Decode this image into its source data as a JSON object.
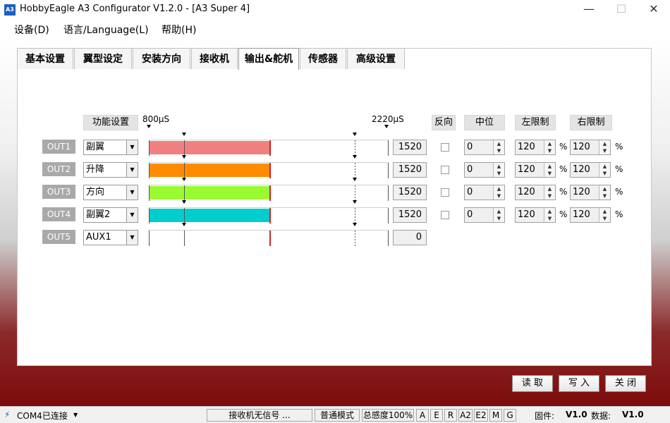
{
  "window": {
    "app_icon_text": "A3",
    "title": "HobbyEagle A3 Configurator V1.2.0 - [A3 Super 4]",
    "minimize": "—",
    "maximize": "☐",
    "close": "✕"
  },
  "menu": [
    "设备(D)",
    "语言/Language(L)",
    "帮助(H)"
  ],
  "tabs": [
    {
      "label": "基本设置"
    },
    {
      "label": "翼型设定"
    },
    {
      "label": "安装方向"
    },
    {
      "label": "接收机"
    },
    {
      "label": "输出&舵机"
    },
    {
      "label": "传感器"
    },
    {
      "label": "高级设置"
    }
  ],
  "headers": {
    "function": "功能设置",
    "scale_min": "800µS",
    "scale_max": "2220µS",
    "reverse": "反向",
    "center": "中位",
    "left_limit": "左限制",
    "right_limit": "右限制"
  },
  "outputs": [
    {
      "label": "OUT1",
      "function": "副翼",
      "value": "1520",
      "bar_fraction": 0.507,
      "bar_color": "#f08080",
      "has_settings": true,
      "reverse": false,
      "center": "0",
      "left": "120",
      "right": "120"
    },
    {
      "label": "OUT2",
      "function": "升降",
      "value": "1520",
      "bar_fraction": 0.507,
      "bar_color": "#ff8c00",
      "has_settings": true,
      "reverse": false,
      "center": "0",
      "left": "120",
      "right": "120"
    },
    {
      "label": "OUT3",
      "function": "方向",
      "value": "1520",
      "bar_fraction": 0.507,
      "bar_color": "#9afa32",
      "has_settings": true,
      "reverse": false,
      "center": "0",
      "left": "120",
      "right": "120"
    },
    {
      "label": "OUT4",
      "function": "副翼2",
      "value": "1520",
      "bar_fraction": 0.507,
      "bar_color": "#00cdcd",
      "has_settings": true,
      "reverse": false,
      "center": "0",
      "left": "120",
      "right": "120"
    },
    {
      "label": "OUT5",
      "function": "AUX1",
      "value": "0",
      "bar_fraction": 0,
      "bar_color": "#ffffff",
      "has_settings": false
    }
  ],
  "percent_sign": "%",
  "buttons": {
    "read": "读 取",
    "write": "写 入",
    "close": "关 闭"
  },
  "status": {
    "port": "COM4已连接",
    "receiver": "接收机无信号 ...",
    "mode": "普通模式",
    "sensitivity": "总感度100%",
    "channels": [
      "A",
      "E",
      "R",
      "A2",
      "E2",
      "M",
      "G"
    ],
    "firmware_label": "固件:",
    "firmware_value": "V1.0",
    "data_label": "数据:",
    "data_value": "V1.0"
  }
}
